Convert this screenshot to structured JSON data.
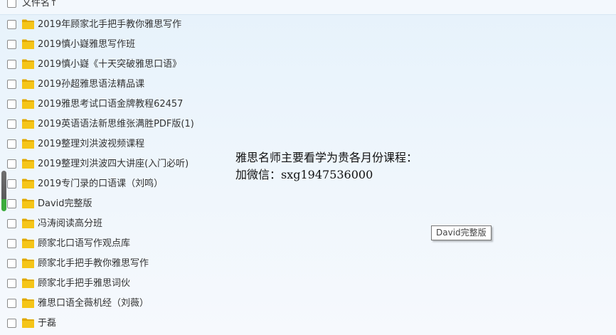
{
  "header": {
    "column_label": "文件名↑"
  },
  "files": [
    {
      "name": "2019年顾家北手把手教你雅思写作",
      "icon": "folder-icon"
    },
    {
      "name": "2019慎小嶷雅思写作班",
      "icon": "folder-icon"
    },
    {
      "name": "2019慎小嶷《十天突破雅思口语》",
      "icon": "folder-icon"
    },
    {
      "name": "2019孙超雅思语法精品课",
      "icon": "folder-icon"
    },
    {
      "name": "2019雅思考试口语金牌教程62457",
      "icon": "folder-icon"
    },
    {
      "name": "2019英语语法新思维张满胜PDF版(1)",
      "icon": "folder-icon"
    },
    {
      "name": "2019整理刘洪波视频课程",
      "icon": "folder-icon"
    },
    {
      "name": "2019整理刘洪波四大讲座(入门必听)",
      "icon": "folder-icon"
    },
    {
      "name": "2019专门录的口语课（刘鸣）",
      "icon": "folder-icon"
    },
    {
      "name": "David完整版",
      "icon": "folder-icon"
    },
    {
      "name": "冯涛阅读高分班",
      "icon": "folder-icon"
    },
    {
      "name": "顾家北口语写作观点库",
      "icon": "folder-icon"
    },
    {
      "name": "顾家北手把手教你雅思写作",
      "icon": "folder-icon"
    },
    {
      "name": "顾家北手把手雅思词伙",
      "icon": "folder-icon"
    },
    {
      "name": "雅思口语全薇机经（刘薇）",
      "icon": "folder-icon"
    },
    {
      "name": "于磊",
      "icon": "folder-icon"
    }
  ],
  "overlay": {
    "line1": "雅思名师主要看学为贵各月份课程：",
    "line2": "加微信：sxg1947536000"
  },
  "tooltip": {
    "text": "David完整版"
  },
  "colors": {
    "folder": "#f5c518",
    "folder_dark": "#e0a800",
    "scroll_green": "#3cab3c"
  }
}
